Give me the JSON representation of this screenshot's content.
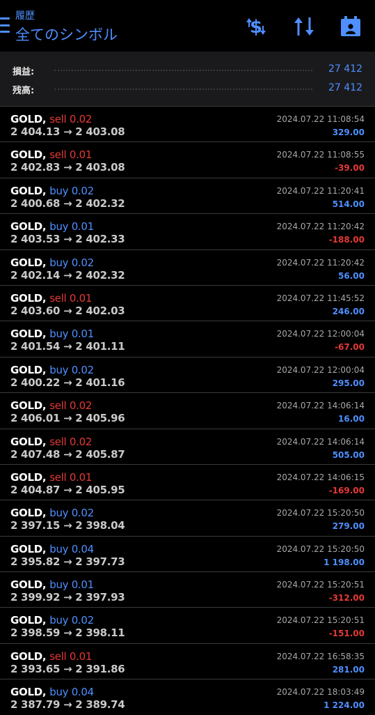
{
  "header": {
    "subtitle": "履歴",
    "title": "全てのシンボル",
    "icons": [
      "menu-icon",
      "dollar-exchange-icon",
      "sort-icon",
      "calendar-icon"
    ]
  },
  "summary": [
    {
      "label": "損益:",
      "value": "27 412"
    },
    {
      "label": "残高:",
      "value": "27 412"
    }
  ],
  "colors": {
    "buy": "#4f8fff",
    "sell": "#e53935",
    "profit": "#4f8fff",
    "loss": "#e53935"
  },
  "trades": [
    {
      "symbol": "GOLD,",
      "side": "sell 0.02",
      "type": "sell",
      "prices": "2 404.13 → 2 403.08",
      "time": "2024.07.22 11:08:54",
      "pl": "329.00",
      "pl_sign": "pos"
    },
    {
      "symbol": "GOLD,",
      "side": "sell 0.01",
      "type": "sell",
      "prices": "2 402.83 → 2 403.08",
      "time": "2024.07.22 11:08:55",
      "pl": "-39.00",
      "pl_sign": "neg"
    },
    {
      "symbol": "GOLD,",
      "side": "buy 0.02",
      "type": "buy",
      "prices": "2 400.68 → 2 402.32",
      "time": "2024.07.22 11:20:41",
      "pl": "514.00",
      "pl_sign": "pos"
    },
    {
      "symbol": "GOLD,",
      "side": "buy 0.01",
      "type": "buy",
      "prices": "2 403.53 → 2 402.33",
      "time": "2024.07.22 11:20:42",
      "pl": "-188.00",
      "pl_sign": "neg"
    },
    {
      "symbol": "GOLD,",
      "side": "buy 0.02",
      "type": "buy",
      "prices": "2 402.14 → 2 402.32",
      "time": "2024.07.22 11:20:42",
      "pl": "56.00",
      "pl_sign": "pos"
    },
    {
      "symbol": "GOLD,",
      "side": "sell 0.01",
      "type": "sell",
      "prices": "2 403.60 → 2 402.03",
      "time": "2024.07.22 11:45:52",
      "pl": "246.00",
      "pl_sign": "pos"
    },
    {
      "symbol": "GOLD,",
      "side": "buy 0.01",
      "type": "buy",
      "prices": "2 401.54 → 2 401.11",
      "time": "2024.07.22 12:00:04",
      "pl": "-67.00",
      "pl_sign": "neg"
    },
    {
      "symbol": "GOLD,",
      "side": "buy 0.02",
      "type": "buy",
      "prices": "2 400.22 → 2 401.16",
      "time": "2024.07.22 12:00:04",
      "pl": "295.00",
      "pl_sign": "pos"
    },
    {
      "symbol": "GOLD,",
      "side": "sell 0.02",
      "type": "sell",
      "prices": "2 406.01 → 2 405.96",
      "time": "2024.07.22 14:06:14",
      "pl": "16.00",
      "pl_sign": "pos"
    },
    {
      "symbol": "GOLD,",
      "side": "sell 0.02",
      "type": "sell",
      "prices": "2 407.48 → 2 405.87",
      "time": "2024.07.22 14:06:14",
      "pl": "505.00",
      "pl_sign": "pos"
    },
    {
      "symbol": "GOLD,",
      "side": "sell 0.01",
      "type": "sell",
      "prices": "2 404.87 → 2 405.95",
      "time": "2024.07.22 14:06:15",
      "pl": "-169.00",
      "pl_sign": "neg"
    },
    {
      "symbol": "GOLD,",
      "side": "buy 0.02",
      "type": "buy",
      "prices": "2 397.15 → 2 398.04",
      "time": "2024.07.22 15:20:50",
      "pl": "279.00",
      "pl_sign": "pos"
    },
    {
      "symbol": "GOLD,",
      "side": "buy 0.04",
      "type": "buy",
      "prices": "2 395.82 → 2 397.73",
      "time": "2024.07.22 15:20:50",
      "pl": "1 198.00",
      "pl_sign": "pos"
    },
    {
      "symbol": "GOLD,",
      "side": "buy 0.01",
      "type": "buy",
      "prices": "2 399.92 → 2 397.93",
      "time": "2024.07.22 15:20:51",
      "pl": "-312.00",
      "pl_sign": "neg"
    },
    {
      "symbol": "GOLD,",
      "side": "buy 0.02",
      "type": "buy",
      "prices": "2 398.59 → 2 398.11",
      "time": "2024.07.22 15:20:51",
      "pl": "-151.00",
      "pl_sign": "neg"
    },
    {
      "symbol": "GOLD,",
      "side": "sell 0.01",
      "type": "sell",
      "prices": "2 393.65 → 2 391.86",
      "time": "2024.07.22 16:58:35",
      "pl": "281.00",
      "pl_sign": "pos"
    },
    {
      "symbol": "GOLD,",
      "side": "buy 0.04",
      "type": "buy",
      "prices": "2 387.79 → 2 389.74",
      "time": "2024.07.22 18:03:49",
      "pl": "1 224.00",
      "pl_sign": "pos"
    }
  ]
}
